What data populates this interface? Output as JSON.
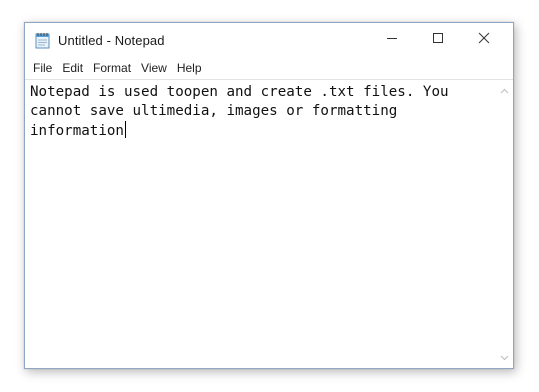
{
  "window": {
    "title": "Untitled - Notepad",
    "app_icon": "notepad-icon"
  },
  "caption_buttons": {
    "minimize_icon": "minimize-icon",
    "maximize_icon": "maximize-icon",
    "close_icon": "close-icon"
  },
  "menu": {
    "items": [
      {
        "label": "File"
      },
      {
        "label": "Edit"
      },
      {
        "label": "Format"
      },
      {
        "label": "View"
      },
      {
        "label": "Help"
      }
    ]
  },
  "editor": {
    "text": "Notepad is used toopen and create .txt files. You cannot save ultimedia, images or formatting information"
  },
  "scrollbar": {
    "up_icon": "scroll-up-arrow-icon",
    "down_icon": "scroll-down-arrow-icon"
  },
  "colors": {
    "window_border": "#8fa6c4",
    "text": "#111111",
    "scroll_arrow": "#c2c2c2"
  }
}
